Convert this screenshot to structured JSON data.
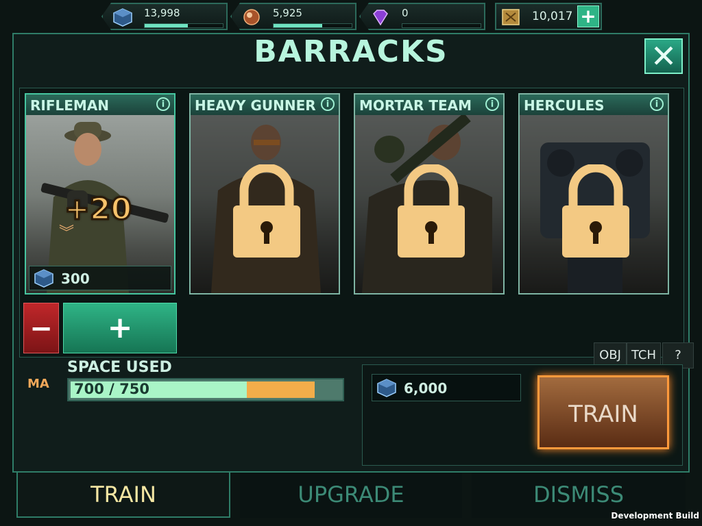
{
  "resources": [
    {
      "name": "crystal",
      "value": "13,998",
      "fill": 0.55
    },
    {
      "name": "ore",
      "value": "5,925",
      "fill": 0.62
    },
    {
      "name": "gem",
      "value": "0",
      "fill": 0
    },
    {
      "name": "medal",
      "value": "10,017"
    }
  ],
  "screen_title": "BARRACKS",
  "units": [
    {
      "name": "RIFLEMAN",
      "locked": false,
      "queued": "+20",
      "cost": "300"
    },
    {
      "name": "HEAVY GUNNER",
      "locked": true
    },
    {
      "name": "MORTAR TEAM",
      "locked": true
    },
    {
      "name": "HERCULES",
      "locked": true
    }
  ],
  "buttons": {
    "minus": "−",
    "plus": "+",
    "train": "TRAIN",
    "obj": "OBJ",
    "tch": "TCH",
    "help": "?"
  },
  "space": {
    "label": "SPACE USED",
    "text": "700 / 750",
    "used": 700,
    "total": 750,
    "pending_fraction": 0.25
  },
  "rank_badge": "MA",
  "total_cost": "6,000",
  "tabs": {
    "train": "TRAIN",
    "upgrade": "UPGRADE",
    "dismiss": "DISMISS"
  },
  "footer": "Development Build",
  "colors": {
    "accent": "#2f7d68",
    "train_glow": "#ff9a3c",
    "minus": "#c0272a",
    "plus": "#2fb486"
  }
}
